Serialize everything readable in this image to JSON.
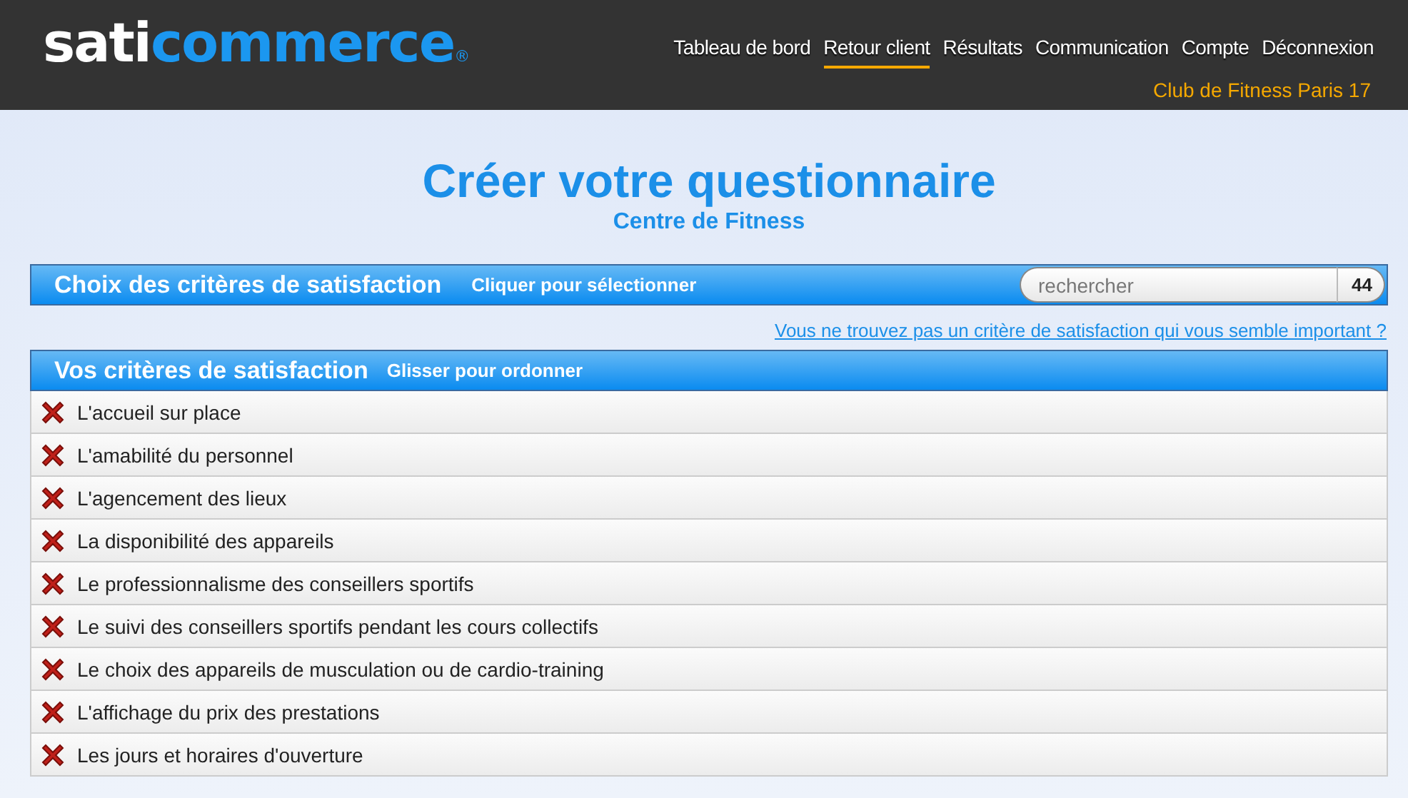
{
  "logo": {
    "prefix": "sati",
    "suffix": "commerce",
    "mark": "®"
  },
  "nav": [
    {
      "label": "Tableau de bord",
      "selected": false
    },
    {
      "label": "Retour client",
      "selected": true
    },
    {
      "label": "Résultats",
      "selected": false
    },
    {
      "label": "Communication",
      "selected": false
    },
    {
      "label": "Compte",
      "selected": false
    },
    {
      "label": "Déconnexion",
      "selected": false
    }
  ],
  "account": "Club de Fitness Paris 17",
  "title": "Créer votre questionnaire",
  "subtitle": "Centre de Fitness",
  "choice_panel": {
    "title": "Choix des critères de satisfaction",
    "hint": "Cliquer pour sélectionner",
    "search": {
      "placeholder": "rechercher"
    },
    "count": "44"
  },
  "suggest_link": "Vous ne trouvez pas un critère de satisfaction qui vous semble important ?",
  "selected_panel": {
    "title": "Vos critères de satisfaction",
    "hint": "Glisser pour ordonner"
  },
  "criteria": [
    "L'accueil sur place",
    "L'amabilité du personnel",
    "L'agencement des lieux",
    "La disponibilité des appareils",
    "Le professionnalisme des conseillers sportifs",
    "Le suivi des conseillers sportifs pendant les cours collectifs",
    "Le choix des appareils de musculation ou de cardio-training",
    "L'affichage du prix des prestations",
    "Les jours et horaires d'ouverture"
  ]
}
